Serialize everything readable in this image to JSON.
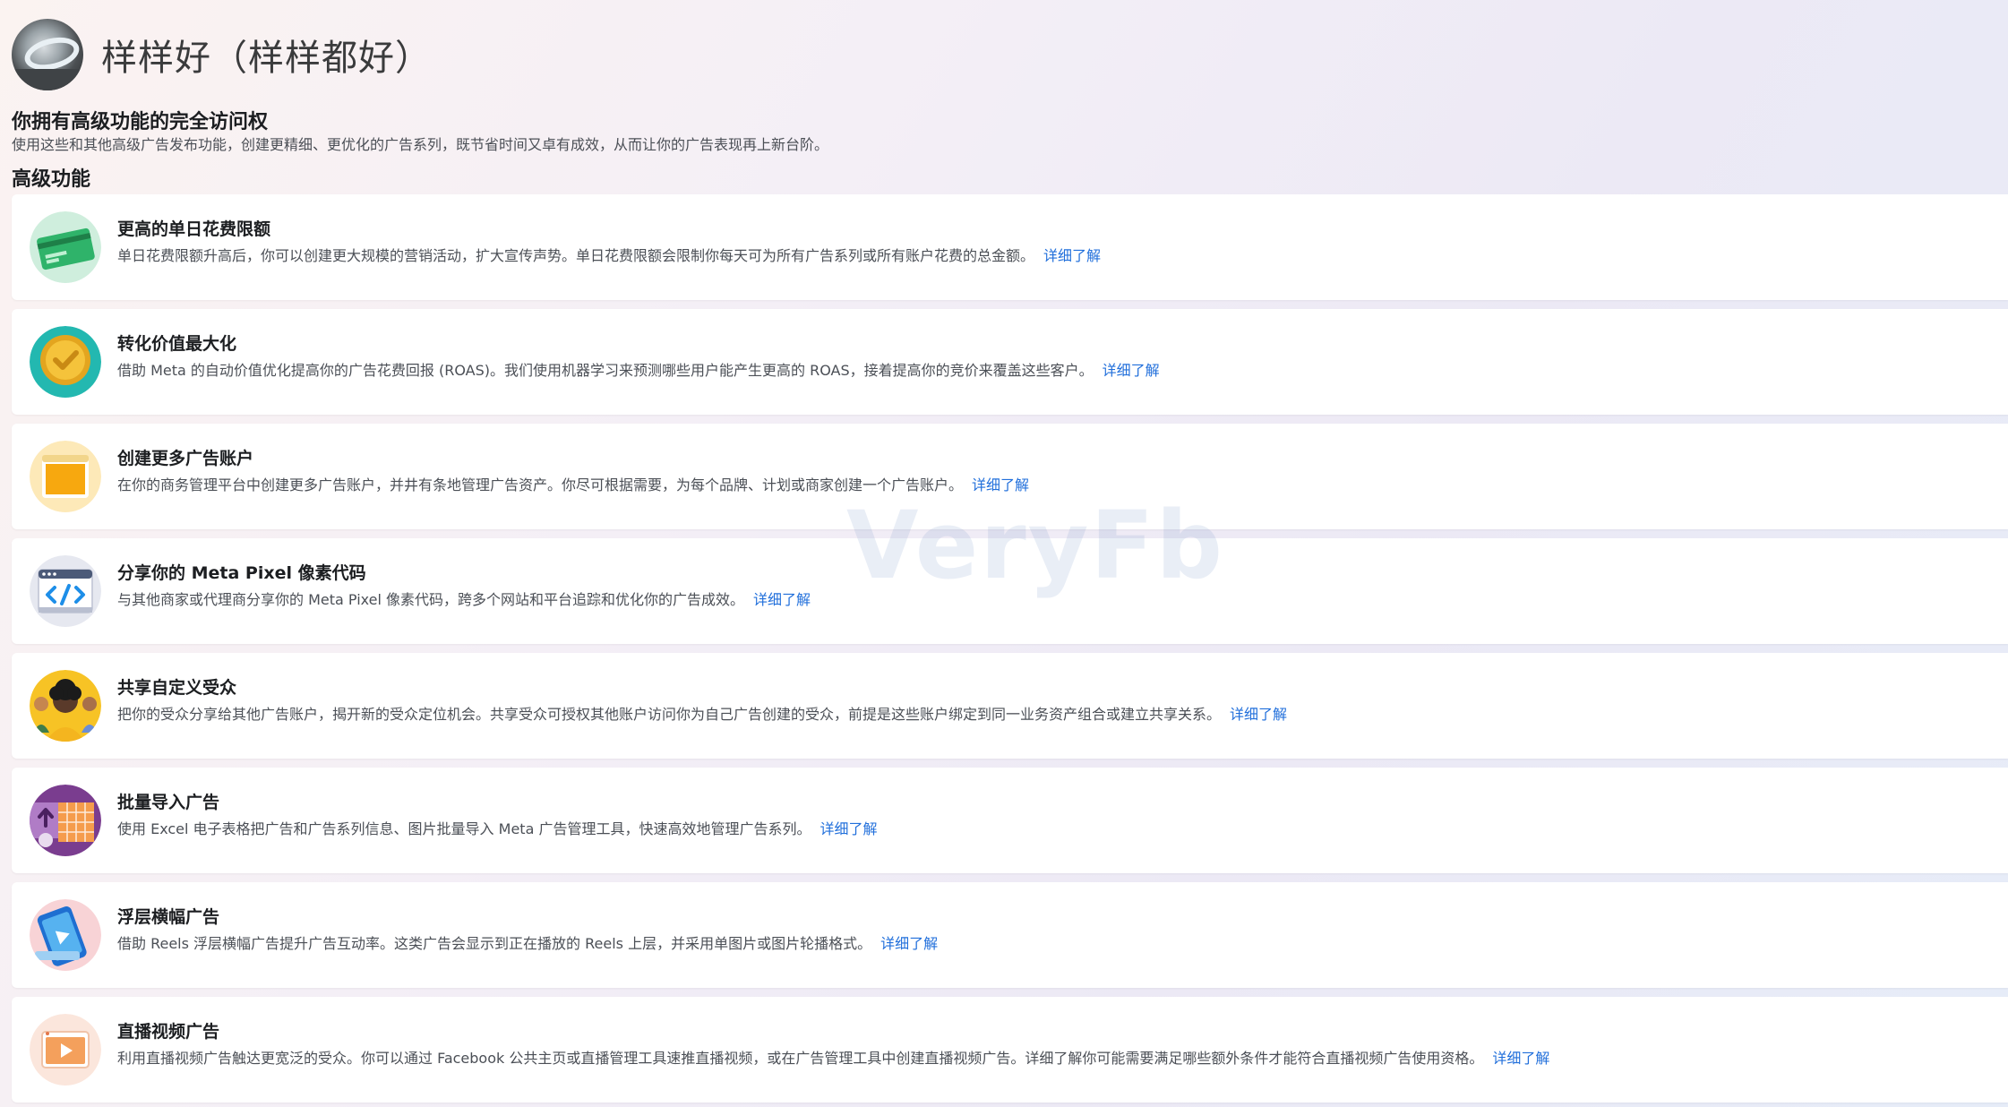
{
  "profile": {
    "name": "样样好（样样都好）"
  },
  "access": {
    "title": "你拥有高级功能的完全访问权",
    "description": "使用这些和其他高级广告发布功能，创建更精细、更优化的广告系列，既节省时间又卓有成效，从而让你的广告表现再上新台阶。"
  },
  "section_title": "高级功能",
  "learn_more_label": "详细了解",
  "features": [
    {
      "title": "更高的单日花费限额",
      "description": "单日花费限额升高后，你可以创建更大规模的营销活动，扩大宣传声势。单日花费限额会限制你每天可为所有广告系列或所有账户花费的总金额。",
      "icon": "credit-card-icon",
      "colors": {
        "bg": "#cfeedd",
        "main": "#2fb36a"
      }
    },
    {
      "title": "转化价值最大化",
      "description": "借助 Meta 的自动价值优化提高你的广告花费回报 (ROAS)。我们使用机器学习来预测哪些用户能产生更高的 ROAS，接着提高你的竞价来覆盖这些客户。",
      "icon": "gold-coin-icon",
      "colors": {
        "bg": "#23b8b0",
        "main": "#f5c33b"
      }
    },
    {
      "title": "创建更多广告账户",
      "description": "在你的商务管理平台中创建更多广告账户，并井有条地管理广告资产。你尽可根据需要，为每个品牌、计划或商家创建一个广告账户。",
      "icon": "ad-account-icon",
      "colors": {
        "bg": "#fde9b8",
        "main": "#f7a80f"
      }
    },
    {
      "title": "分享你的 Meta Pixel 像素代码",
      "description": "与其他商家或代理商分享你的 Meta Pixel 像素代码，跨多个网站和平台追踪和优化你的广告成效。",
      "icon": "code-window-icon",
      "colors": {
        "bg": "#e6e8f0",
        "main": "#1d8ee8"
      }
    },
    {
      "title": "共享自定义受众",
      "description": "把你的受众分享给其他广告账户，揭开新的受众定位机会。共享受众可授权其他账户访问你为自己广告创建的受众，前提是这些账户绑定到同一业务资产组合或建立共享关系。",
      "icon": "audience-icon",
      "colors": {
        "bg": "#f7c325",
        "main": "#5a3a2a"
      }
    },
    {
      "title": "批量导入广告",
      "description": "使用 Excel 电子表格把广告和广告系列信息、图片批量导入 Meta 广告管理工具，快速高效地管理广告系列。",
      "icon": "spreadsheet-icon",
      "colors": {
        "bg": "#7a3d8f",
        "main": "#f59c4c"
      }
    },
    {
      "title": "浮层横幅广告",
      "description": "借助 Reels 浮层横幅广告提升广告互动率。这类广告会显示到正在播放的 Reels 上层，并采用单图片或图片轮播格式。",
      "icon": "reels-banner-icon",
      "colors": {
        "bg": "#f8d3d6",
        "main": "#2d8fe0"
      }
    },
    {
      "title": "直播视频广告",
      "description": "利用直播视频广告触达更宽泛的受众。你可以通过 Facebook 公共主页或直播管理工具速推直播视频，或在广告管理工具中创建直播视频广告。详细了解你可能需要满足哪些额外条件才能符合直播视频广告使用资格。",
      "icon": "live-video-icon",
      "colors": {
        "bg": "#fbe6dc",
        "main": "#f4a05c"
      }
    }
  ],
  "watermark": "VeryFb"
}
